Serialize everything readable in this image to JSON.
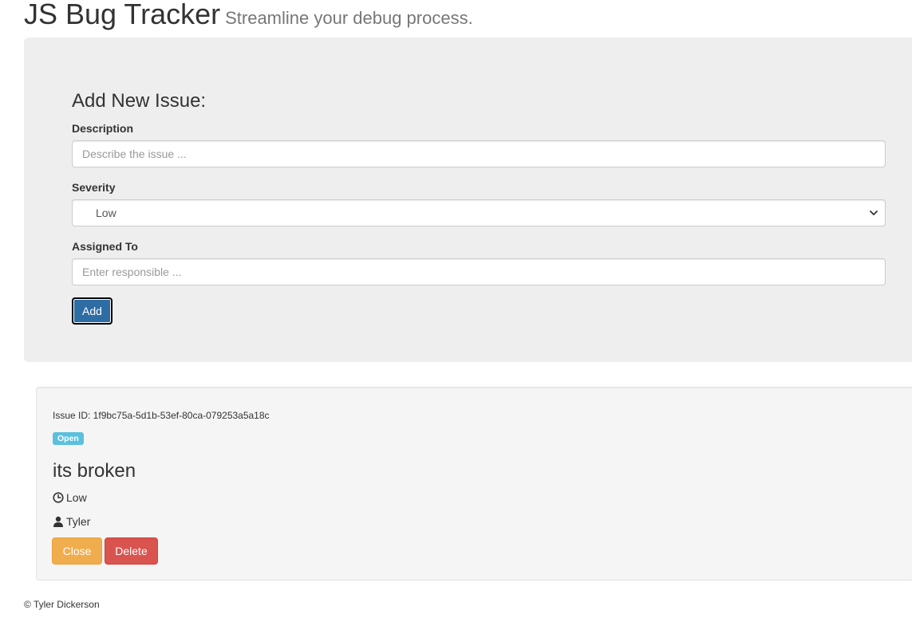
{
  "header": {
    "title": "JS Bug Tracker",
    "subtitle": "Streamline your debug process."
  },
  "form": {
    "title": "Add New Issue:",
    "description": {
      "label": "Description",
      "placeholder": "Describe the issue ...",
      "value": ""
    },
    "severity": {
      "label": "Severity",
      "selected": "Low"
    },
    "assigned_to": {
      "label": "Assigned To",
      "placeholder": "Enter responsible ...",
      "value": ""
    },
    "add_label": "Add"
  },
  "issues": [
    {
      "id_text": "Issue ID: 1f9bc75a-5d1b-53ef-80ca-079253a5a18c",
      "status": "Open",
      "description": "its broken",
      "severity": "Low",
      "assigned_to": "Tyler",
      "close_label": "Close",
      "delete_label": "Delete"
    }
  ],
  "footer": {
    "text": "© Tyler Dickerson"
  },
  "colors": {
    "primary": "#337ab7",
    "warning": "#f0ad4e",
    "danger": "#d9534f",
    "info": "#5bc0de",
    "jumbotron_bg": "#eeeeee",
    "well_bg": "#f5f5f5"
  },
  "icons": {
    "severity": "clock-icon",
    "assignee": "user-icon",
    "select": "chevron-down-icon"
  }
}
